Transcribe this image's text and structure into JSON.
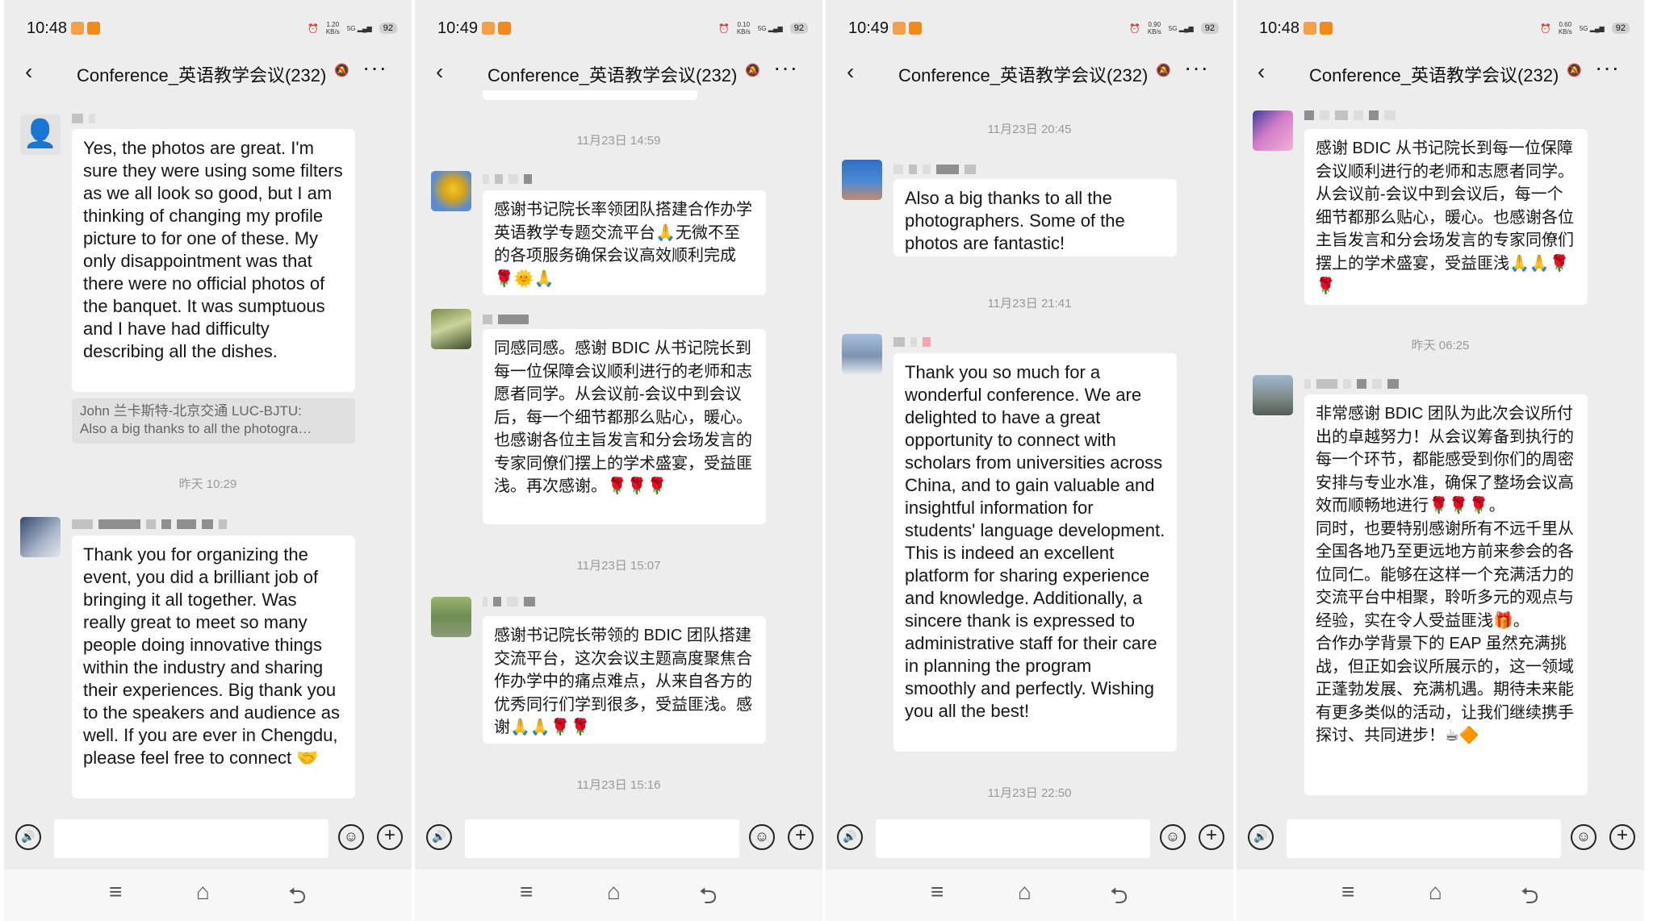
{
  "chat_title": "Conference_英语教学会议(232)",
  "icons": {
    "back": "‹",
    "mute": "🔕",
    "more": "···",
    "voice": "🔊",
    "emoji": "☺",
    "plus": "+",
    "nav_menu": "≡",
    "nav_home": "⌂",
    "nav_back": "⮌"
  },
  "phones": [
    {
      "status": {
        "time": "10:48",
        "speed": "1.20\nKB/s",
        "battery": "92"
      },
      "messages": [
        {
          "text": "Yes, the photos are great. I'm sure they were using some filters as we all look so good, but I am thinking of changing my profile picture to for one of these. My only disappointment was that there were no official photos of the banquet. It was sumptuous and I have had difficulty describing all the dishes.",
          "quote_line1": "John 兰卡斯特-北京交通 LUC-BJTU:",
          "quote_line2": "Also a big thanks to all the photogra…"
        },
        {
          "time": "昨天 10:29"
        },
        {
          "text": "Thank you for organizing the event, you did a brilliant job of bringing it all together. Was really great to meet so many people doing innovative things within the industry and sharing their experiences. Big thank you to the speakers and audience as well. If you are ever in Chengdu, please feel free to connect",
          "emoji": "🤝"
        }
      ]
    },
    {
      "status": {
        "time": "10:49",
        "speed": "0.10\nKB/s",
        "battery": "92"
      },
      "messages": [
        {
          "time": "11月23日 14:59"
        },
        {
          "text": "感谢书记院长率领团队搭建合作办学英语教学专题交流平台🙏无微不至的各项服务确保会议高效顺利完成🌹🌞🙏"
        },
        {
          "text": "同感同感。感谢 BDIC 从书记院长到每一位保障会议顺利进行的老师和志愿者同学。从会议前-会议中到会议后，每一个细节都那么贴心，暖心。也感谢各位主旨发言和分会场发言的专家同僚们摆上的学术盛宴，受益匪浅。再次感谢。🌹🌹🌹"
        },
        {
          "time": "11月23日 15:07"
        },
        {
          "text": "感谢书记院长带领的 BDIC 团队搭建交流平台，这次会议主题高度聚焦合作办学中的痛点难点，从来自各方的优秀同行们学到很多，受益匪浅。感谢🙏🙏🌹🌹"
        },
        {
          "time": "11月23日 15:16"
        }
      ]
    },
    {
      "status": {
        "time": "10:49",
        "speed": "0.90\nKB/s",
        "battery": "92"
      },
      "messages": [
        {
          "time": "11月23日 20:45"
        },
        {
          "text": "Also a big thanks to all the photographers. Some of the photos are fantastic!"
        },
        {
          "time": "11月23日 21:41"
        },
        {
          "text": "Thank you so much for a wonderful conference. We are delighted to have a great opportunity to connect with scholars from universities across China, and to gain valuable and insightful information for students' language development. This is indeed an excellent platform for sharing experience and knowledge. Additionally, a sincere thank is expressed to administrative staff for their care in planning the program smoothly and perfectly. Wishing you all the best!"
        },
        {
          "time": "11月23日 22:50"
        }
      ]
    },
    {
      "status": {
        "time": "10:48",
        "speed": "0.60\nKB/s",
        "battery": "92"
      },
      "messages": [
        {
          "text": "感谢 BDIC 从书记院长到每一位保障会议顺利进行的老师和志愿者同学。从会议前-会议中到会议后，每一个细节都那么贴心，暖心。也感谢各位主旨发言和分会场发言的专家同僚们摆上的学术盛宴，受益匪浅🙏🙏🌹🌹"
        },
        {
          "time": "昨天 06:25"
        },
        {
          "p1": "非常感谢 BDIC 团队为此次会议所付出的卓越努力！从会议筹备到执行的每一个环节，都能感受到你们的周密安排与专业水准，确保了整场会议高效而顺畅地进行🌹🌹🌹。",
          "p2": "同时，也要特别感谢所有不远千里从全国各地乃至更远地方前来参会的各位同仁。能够在这样一个充满活力的交流平台中相聚，聆听多元的观点与经验，实在令人受益匪浅🎁。",
          "p3": "合作办学背景下的 EAP 虽然充满挑战，但正如会议所展示的，这一领域正蓬勃发展、充满机遇。期待未来能有更多类似的活动，让我们继续携手探讨、共同进步！☕🔶"
        }
      ]
    }
  ]
}
